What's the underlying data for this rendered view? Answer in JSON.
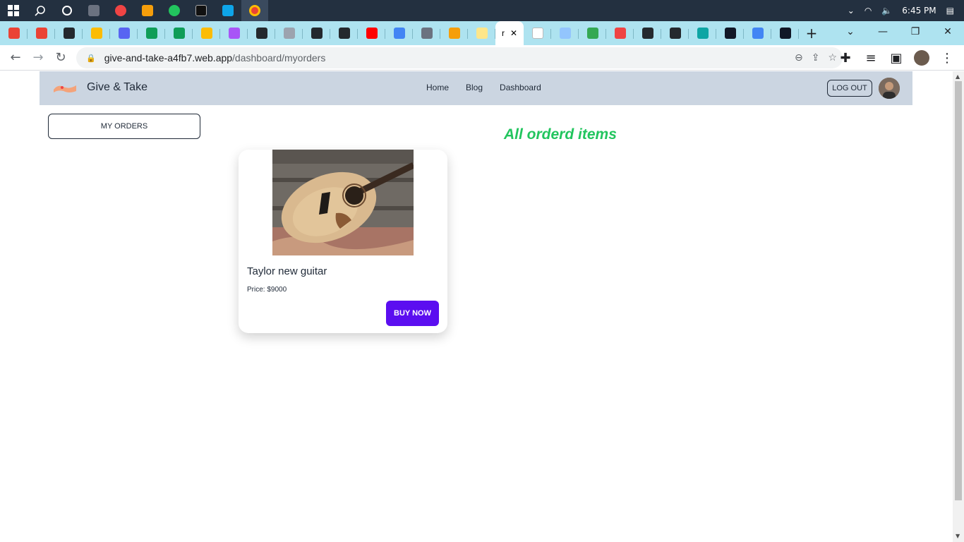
{
  "taskbar": {
    "time": "6:45 PM",
    "icons": [
      "windows-start-icon",
      "search-icon",
      "cortana-icon",
      "calculator-icon",
      "media-icon",
      "file-explorer-icon",
      "edge-icon",
      "terminal-icon",
      "vscode-icon",
      "chrome-icon"
    ]
  },
  "tabs": {
    "active_title": "r",
    "favicon_colors": [
      "#ea4335",
      "#ea4335",
      "#24292e",
      "#fbbc04",
      "#5865f2",
      "#0f9d58",
      "#0f9d58",
      "#fbbc04",
      "#a855f7",
      "#24292e",
      "#9ca3af",
      "#24292e",
      "#24292e",
      "#ff0000",
      "#4285f4",
      "#6b7280",
      "#f59e0b",
      "#fde68a",
      "#ffffff",
      "#93c5fd",
      "#34a853",
      "#ef4444",
      "#24292e",
      "#24292e",
      "#0ea5a4",
      "#111827",
      "#4285f4",
      "#111827"
    ]
  },
  "toolbar": {
    "url_domain": "give-and-take-a4fb7.web.app",
    "url_path": "/dashboard/myorders"
  },
  "page": {
    "brand": "Give & Take",
    "nav": {
      "home": "Home",
      "blog": "Blog",
      "dashboard": "Dashboard"
    },
    "logout_label": "LOG OUT",
    "sidebar_button": "MY ORDERS",
    "heading": "All orderd items",
    "heading_color": "#22c55e",
    "item": {
      "title": "Taylor new guitar",
      "price": "Price: $9000",
      "buy_label": "BUY NOW",
      "buy_color": "#5b0ef0"
    }
  }
}
